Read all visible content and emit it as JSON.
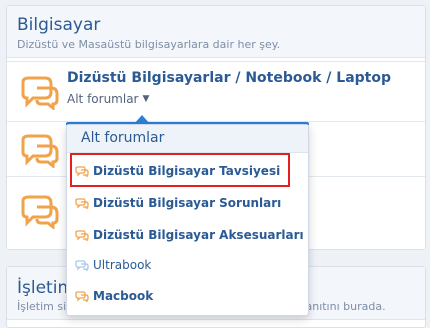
{
  "category": {
    "title": "Bilgisayar",
    "description": "Dizüstü ve Masaüstü bilgisayarlara dair her şey."
  },
  "forum": {
    "title": "Dizüstü Bilgisayarlar / Notebook / Laptop",
    "subforums_toggle": "Alt forumlar"
  },
  "dropdown": {
    "header": "Alt forumlar",
    "items": [
      {
        "label": "Dizüstü Bilgisayar Tavsiyesi",
        "icon": "chat-bubbles-icon",
        "highlighted": true
      },
      {
        "label": "Dizüstü Bilgisayar Sorunları",
        "icon": "chat-bubbles-icon"
      },
      {
        "label": "Dizüstü Bilgisayar Aksesuarları",
        "icon": "chat-bubbles-icon"
      },
      {
        "label": "Ultrabook",
        "icon": "chat-bubbles-icon"
      },
      {
        "label": "Macbook",
        "icon": "chat-bubbles-icon"
      }
    ]
  },
  "next_category": {
    "title": "İşletim",
    "description": "İşletim sistemlerine dair merak edilen her sorunun yanıtını burada."
  },
  "colors": {
    "accent": "#2b7fd9",
    "icon_orange": "#f0a34a",
    "icon_light": "#a9c8e8",
    "highlight_border": "#e32020"
  }
}
